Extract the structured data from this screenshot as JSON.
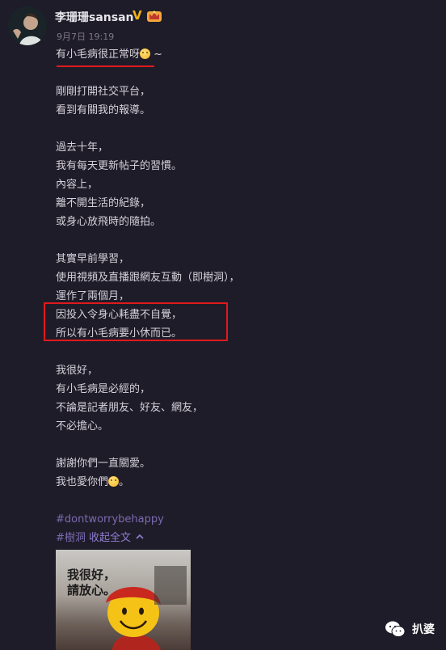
{
  "post": {
    "username": "李珊珊sansan",
    "verified_badge": "V",
    "time": "9月7日 19:19"
  },
  "lines": [
    "有小毛病很正常呀",
    "",
    "剛剛打開社交平台，",
    "看到有關我的報導。",
    "",
    "過去十年，",
    "我有每天更新帖子的習慣。",
    "內容上，",
    "離不開生活的紀錄，",
    "或身心放飛時的隨拍。",
    "",
    "其實早前學習，",
    "使用視頻及直播跟網友互動（即樹洞），",
    "運作了兩個月，",
    "因投入令身心耗盡不自覺，",
    "所以有小毛病要小休而已。",
    "",
    "我很好，",
    "有小毛病是必經的，",
    "不論是記者朋友、好友、網友，",
    "不必擔心。",
    "",
    "謝謝你們一直關愛。",
    "我也愛你們"
  ],
  "first_line_suffix": "~",
  "last_line_suffix": "。",
  "hashtag": "#dontworrybehappy",
  "topic_tag": "#樹洞",
  "collapse_label": "收起全文",
  "image": {
    "line1": "我很好，",
    "line2": "請放心。"
  },
  "watermark": {
    "label": "扒婆"
  },
  "colors": {
    "background": "#1f1c29",
    "highlight": "#e0191c",
    "tag": "#7a6bb0"
  },
  "icons": [
    "avatar",
    "verified-v-icon",
    "crown-badge-icon",
    "smile-emoji-icon",
    "chevron-up-icon",
    "wechat-icon"
  ]
}
